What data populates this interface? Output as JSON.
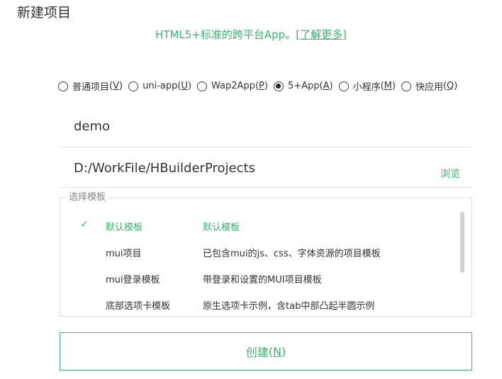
{
  "page": {
    "title": "新建项目"
  },
  "subtitle": {
    "text": "HTML5+标准的跨平台App。",
    "link_prefix": "[",
    "link": "了解更多",
    "link_suffix": "]"
  },
  "project_types": [
    {
      "label": "普通项目",
      "key": "V",
      "selected": false
    },
    {
      "label": "uni-app",
      "key": "U",
      "selected": false
    },
    {
      "label": "Wap2App",
      "key": "P",
      "selected": false
    },
    {
      "label": "5+App",
      "key": "A",
      "selected": true
    },
    {
      "label": "小程序",
      "key": "M",
      "selected": false
    },
    {
      "label": "快应用",
      "key": "Q",
      "selected": false
    }
  ],
  "form": {
    "project_name": "demo",
    "location": "D:/WorkFile/HBuilderProjects",
    "browse_label": "浏览"
  },
  "templates": {
    "legend": "选择模板",
    "check_mark": "✓",
    "items": [
      {
        "name": "默认模板",
        "desc": "默认模板",
        "selected": true
      },
      {
        "name": "mui项目",
        "desc": "已包含mui的js、css、字体资源的项目模板",
        "selected": false
      },
      {
        "name": "mui登录模板",
        "desc": "带登录和设置的MUI项目模板",
        "selected": false
      },
      {
        "name": "底部选项卡模板",
        "desc": "原生选项卡示例，含tab中部凸起半圆示例",
        "selected": false
      }
    ]
  },
  "create_button": {
    "label": "创建",
    "key": "N"
  },
  "colors": {
    "accent": "#3cb371",
    "text": "#333333",
    "border": "#dcdcdc"
  }
}
